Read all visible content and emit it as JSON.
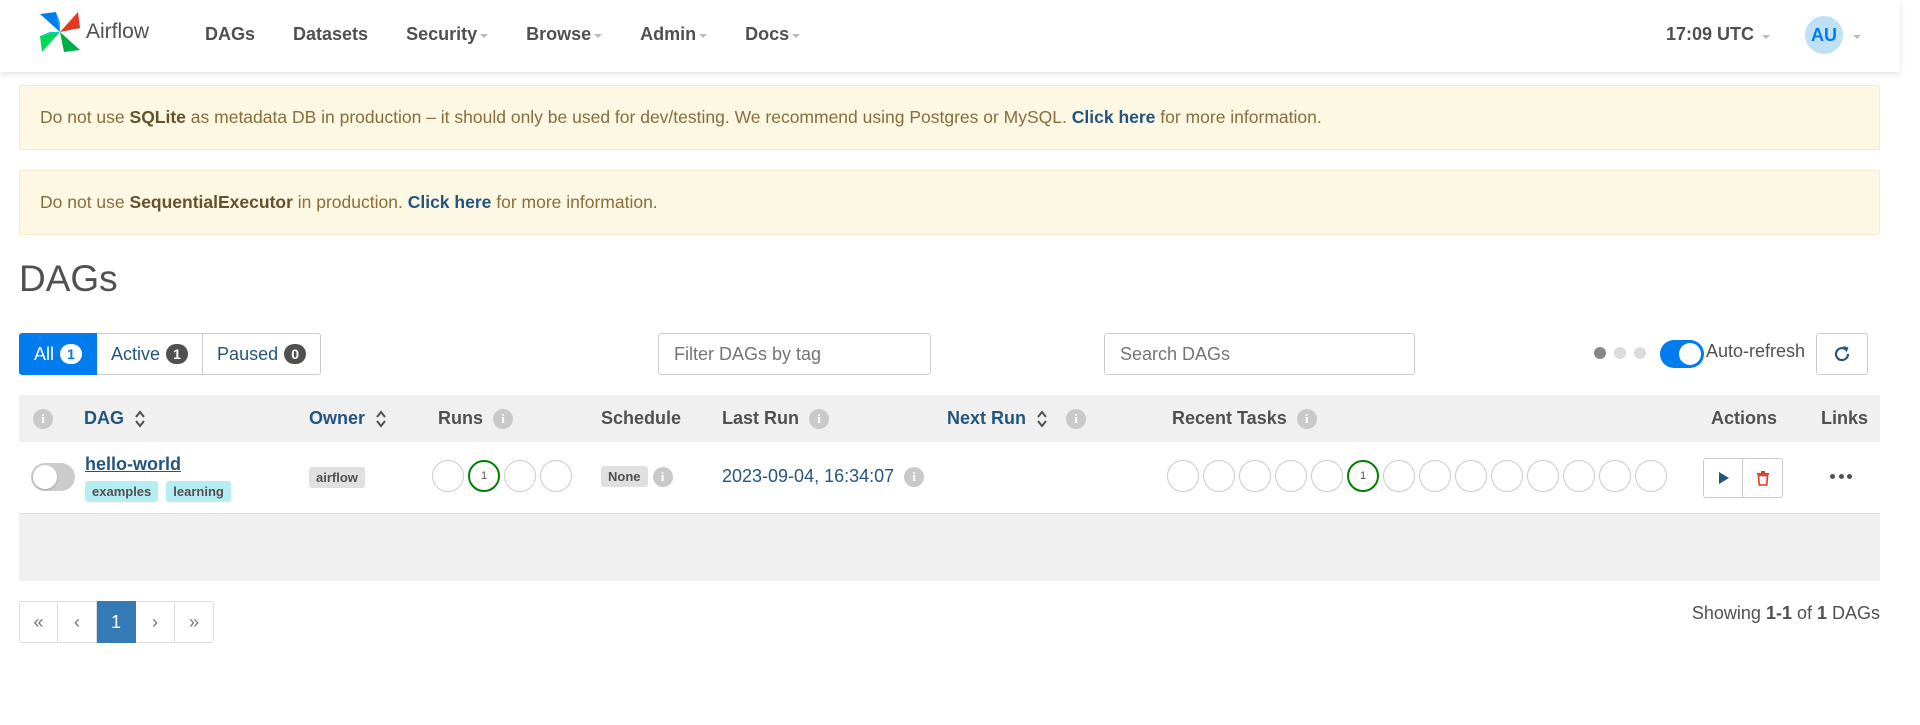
{
  "brand": {
    "name": "Airflow"
  },
  "nav": {
    "items": [
      {
        "label": "DAGs",
        "dropdown": false
      },
      {
        "label": "Datasets",
        "dropdown": false
      },
      {
        "label": "Security",
        "dropdown": true
      },
      {
        "label": "Browse",
        "dropdown": true
      },
      {
        "label": "Admin",
        "dropdown": true
      },
      {
        "label": "Docs",
        "dropdown": true
      }
    ],
    "time": "17:09 UTC",
    "user_initials": "AU"
  },
  "alerts": [
    {
      "pre": "Do not use ",
      "bold": "SQLite",
      "mid": " as metadata DB in production – it should only be used for dev/testing. We recommend using Postgres or MySQL. ",
      "link": "Click here",
      "post": " for more information."
    },
    {
      "pre": "Do not use ",
      "bold": "SequentialExecutor",
      "mid": " in production. ",
      "link": "Click here",
      "post": " for more information."
    }
  ],
  "page_title": "DAGs",
  "filters": {
    "all": {
      "label": "All",
      "count": "1"
    },
    "active": {
      "label": "Active",
      "count": "1"
    },
    "paused": {
      "label": "Paused",
      "count": "0"
    }
  },
  "tag_filter": {
    "placeholder": "Filter DAGs by tag"
  },
  "search": {
    "placeholder": "Search DAGs"
  },
  "auto_refresh": {
    "label": "Auto-refresh",
    "enabled": true
  },
  "table": {
    "headers": {
      "dag": "DAG",
      "owner": "Owner",
      "runs": "Runs",
      "schedule": "Schedule",
      "last_run": "Last Run",
      "next_run": "Next Run",
      "recent_tasks": "Recent Tasks",
      "actions": "Actions",
      "links": "Links"
    },
    "info_glyph": "i",
    "rows": [
      {
        "dag_id": "hello-world",
        "tags": [
          "examples",
          "learning"
        ],
        "owner": "airflow",
        "runs": [
          "",
          "1",
          "",
          ""
        ],
        "schedule": "None",
        "last_run": "2023-09-04, 16:34:07",
        "next_run": "",
        "recent_tasks": [
          "",
          "",
          "",
          "",
          "",
          "1",
          "",
          "",
          "",
          "",
          "",
          "",
          "",
          ""
        ]
      }
    ]
  },
  "pagination": {
    "first": "«",
    "prev": "‹",
    "current": "1",
    "next": "›",
    "last": "»"
  },
  "summary": {
    "prefix": "Showing ",
    "range": "1-1",
    "of": " of ",
    "total": "1",
    "suffix": " DAGs"
  },
  "colors": {
    "accent": "#017cee",
    "success": "#008000",
    "link": "#245580",
    "alert_bg": "#fcf8e3"
  }
}
